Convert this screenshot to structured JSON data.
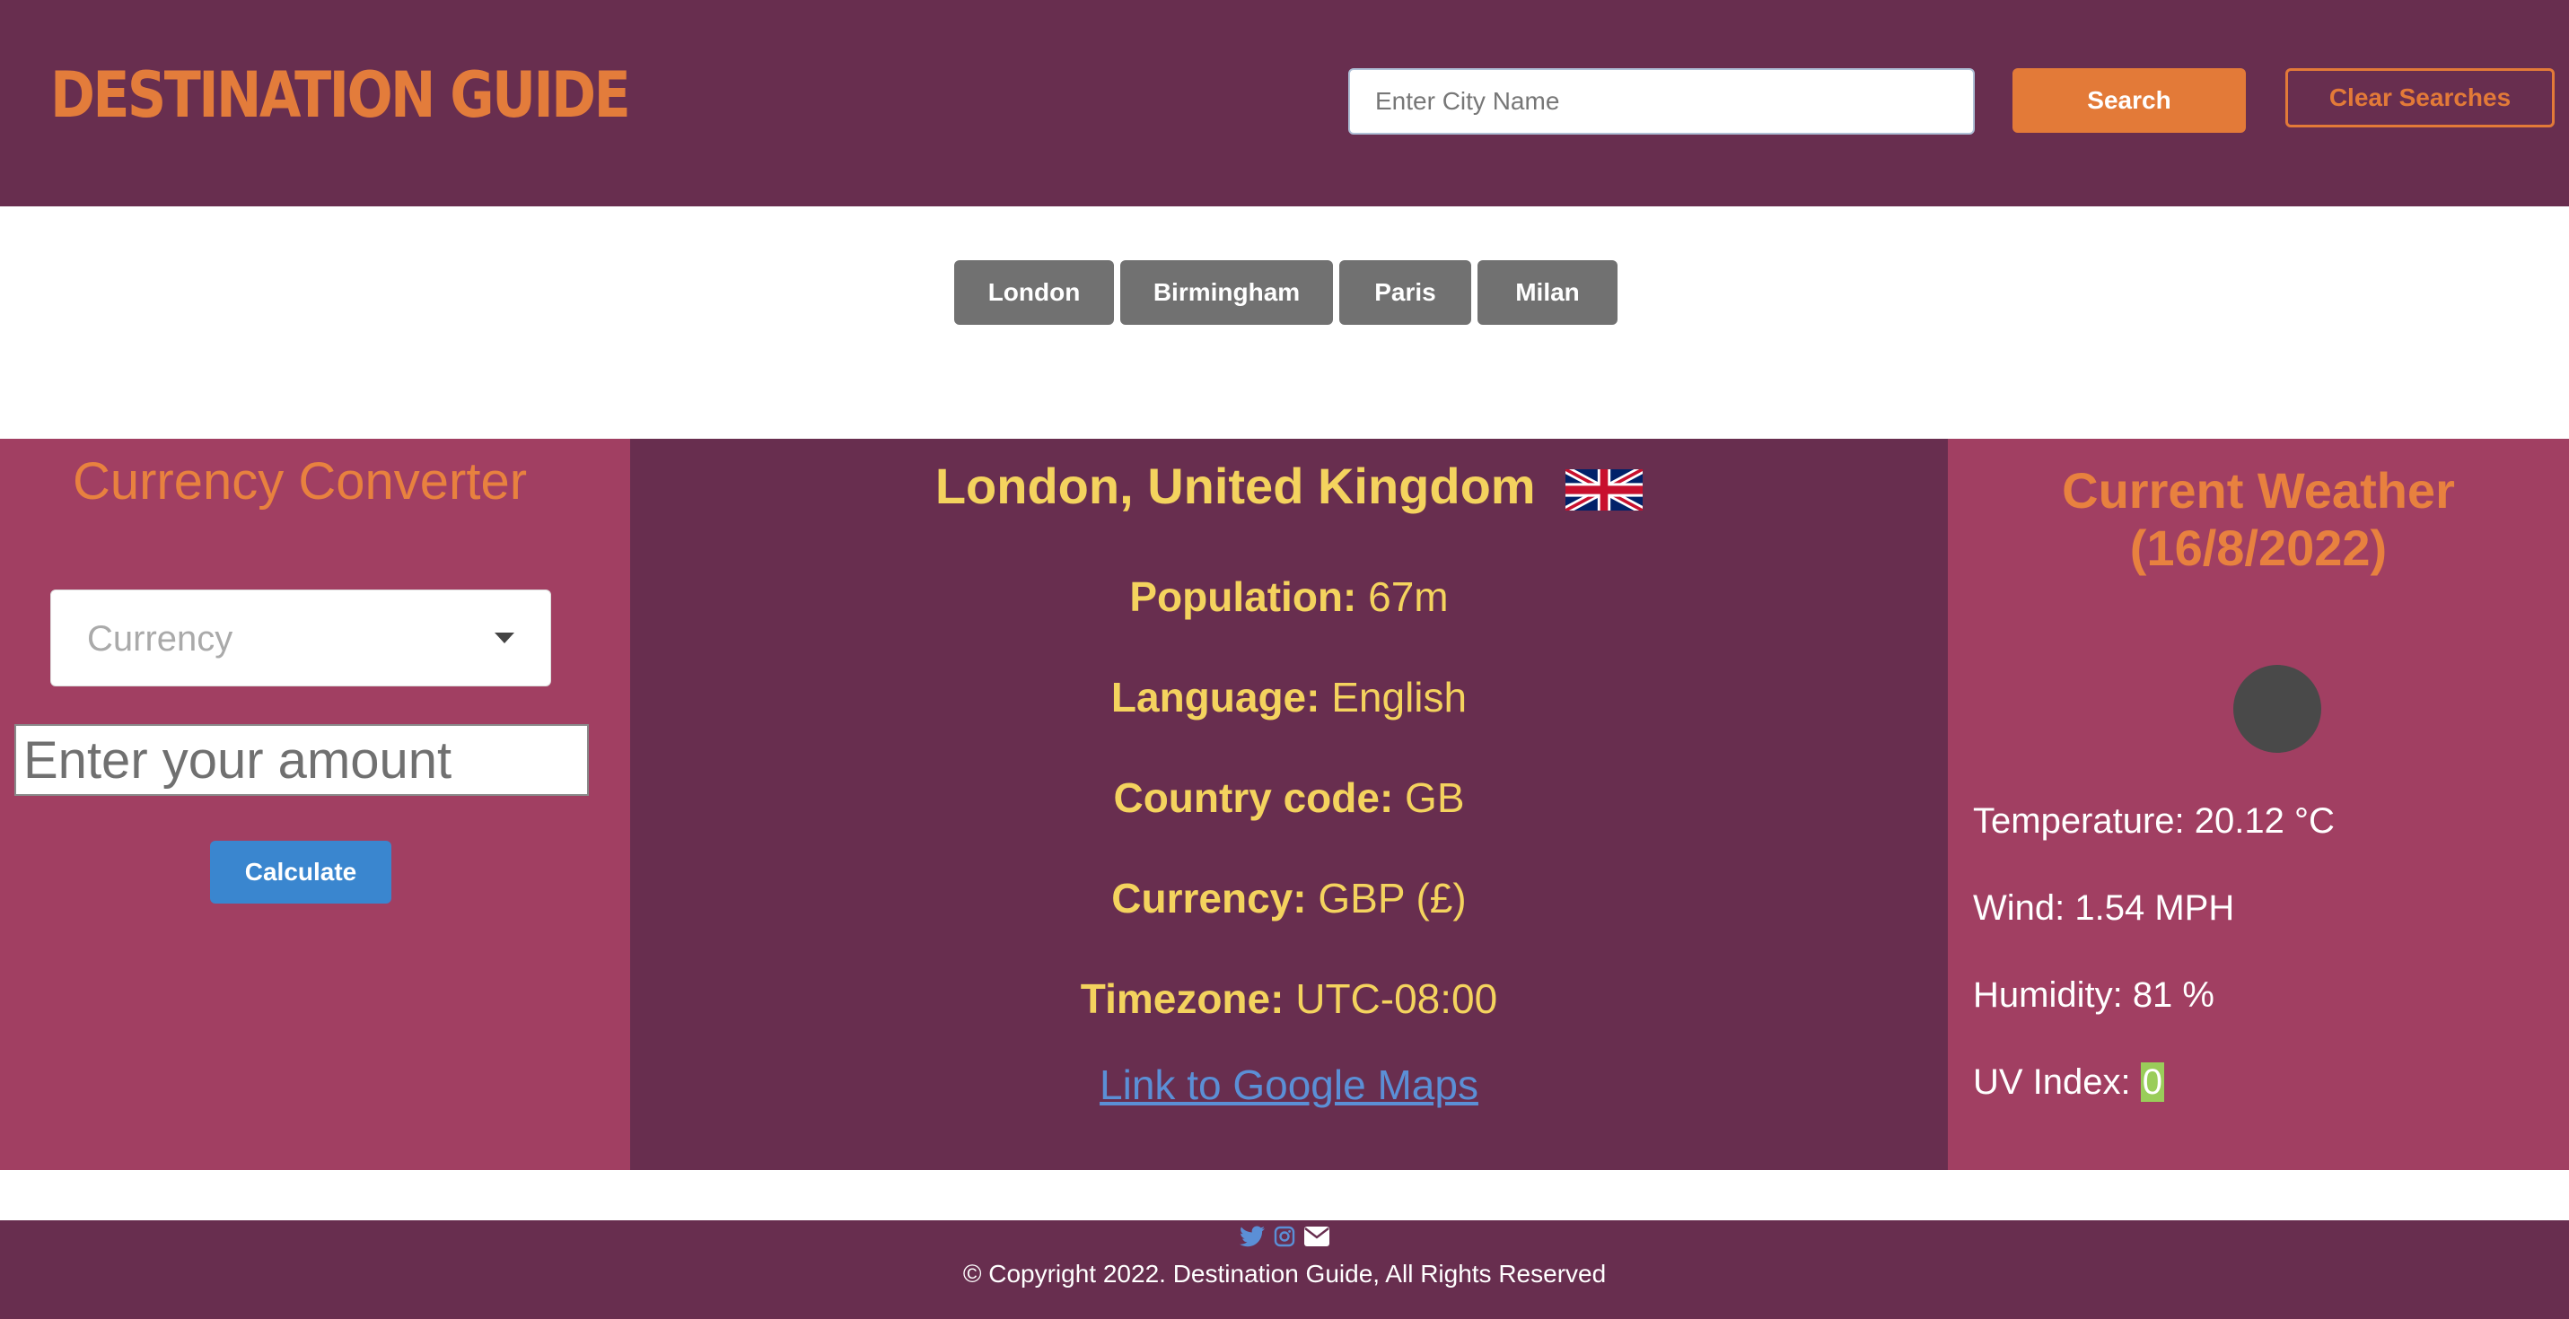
{
  "header": {
    "brand": "DESTINATION GUIDE",
    "search_placeholder": "Enter City Name",
    "search_label": "Search",
    "clear_label": "Clear Searches"
  },
  "history": [
    "London",
    "Birmingham",
    "Paris",
    "Milan"
  ],
  "converter": {
    "title": "Currency Converter",
    "currency_placeholder": "Currency",
    "amount_placeholder": "Enter your amount",
    "calculate_label": "Calculate"
  },
  "city": {
    "title": "London, United Kingdom",
    "flag_icon": "uk-flag-icon",
    "population_label": "Population:",
    "population": "67m",
    "language_label": "Language:",
    "language": "English",
    "country_code_label": "Country code:",
    "country_code": "GB",
    "currency_label": "Currency:",
    "currency": "GBP (£)",
    "timezone_label": "Timezone:",
    "timezone": "UTC-08:00",
    "maps_link": "Link to Google Maps"
  },
  "weather": {
    "title_line1": "Current Weather",
    "title_line2": "(16/8/2022)",
    "temperature": "Temperature: 20.12 °C",
    "wind": "Wind: 1.54 MPH",
    "humidity": "Humidity: 81 %",
    "uv_label": "UV Index:",
    "uv_value": "0"
  },
  "footer": {
    "copyright": "© Copyright 2022. Destination Guide, All Rights Reserved",
    "icons": [
      "twitter-icon",
      "instagram-icon",
      "envelope-icon"
    ]
  },
  "colors": {
    "header_bg": "#682e4f",
    "side_panel_bg": "#a13f62",
    "accent_orange": "#e37a38",
    "info_yellow": "#f4d35e",
    "calc_blue": "#3a86cf",
    "history_gray": "#717171",
    "uv_green": "#9acd5a"
  }
}
